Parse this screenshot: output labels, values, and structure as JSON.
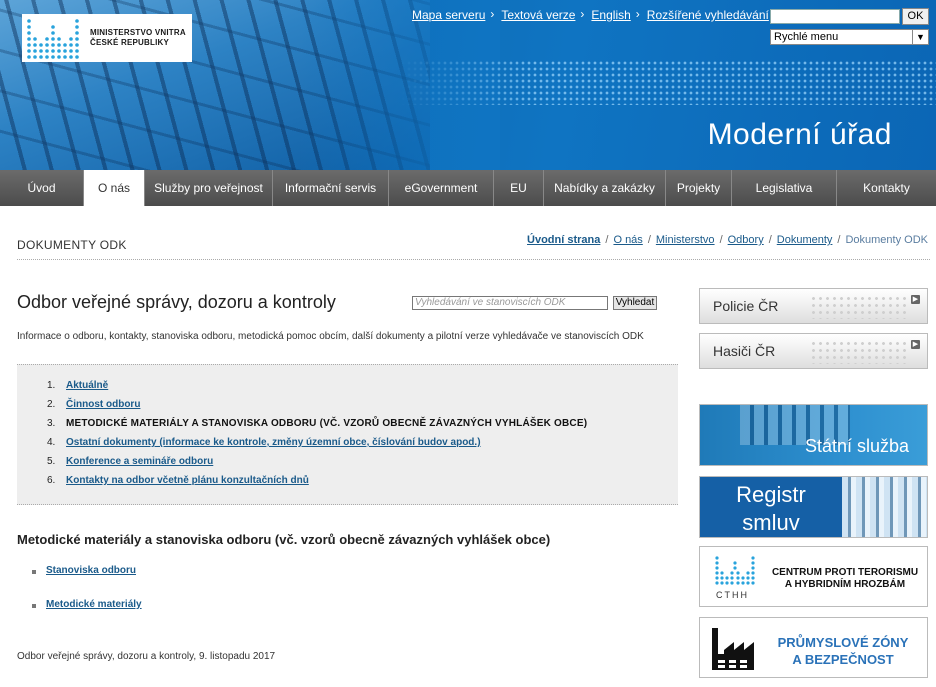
{
  "header": {
    "logo_line1": "MINISTERSTVO VNITRA",
    "logo_line2": "ČESKÉ REPUBLIKY",
    "slogan": "Moderní úřad",
    "top_links": [
      "Mapa serveru",
      "Textová verze",
      "English",
      "Rozšířené vyhledávání"
    ],
    "search_value": "",
    "ok_label": "OK",
    "quick_menu_value": "Rychlé menu"
  },
  "nav": {
    "items": [
      "Úvod",
      "O nás",
      "Služby pro veřejnost",
      "Informační servis",
      "eGovernment",
      "EU",
      "Nabídky a zakázky",
      "Projekty",
      "Legislativa",
      "Kontakty"
    ],
    "active": "O nás"
  },
  "breadcrumb": {
    "section_title": "DOKUMENTY ODK",
    "items": [
      "Úvodní strana",
      "O nás",
      "Ministerstvo",
      "Odbory",
      "Dokumenty"
    ],
    "current": "Dokumenty ODK"
  },
  "main": {
    "title": "Odbor veřejné správy, dozoru a kontroly",
    "search_placeholder": "Vyhledávání ve stanoviscích ODK",
    "search_button": "Vyhledat",
    "intro": "Informace o odboru, kontakty, stanoviska odboru, metodická pomoc obcím, další dokumenty a pilotní verze vyhledávače ve stanoviscích ODK",
    "toc": [
      {
        "num": "1.",
        "label": "Aktuálně",
        "link": true
      },
      {
        "num": "2.",
        "label": "Činnost odboru",
        "link": true
      },
      {
        "num": "3.",
        "label": "METODICKÉ MATERIÁLY A STANOVISKA ODBORU (VČ. VZORŮ OBECNĚ ZÁVAZNÝCH VYHLÁŠEK OBCE)",
        "link": false
      },
      {
        "num": "4.",
        "label": "Ostatní dokumenty (informace ke kontrole, změny územní obce, číslování budov apod.)",
        "link": true
      },
      {
        "num": "5.",
        "label": "Konference a semináře odboru",
        "link": true
      },
      {
        "num": "6.",
        "label": "Kontakty na odbor včetně plánu konzultačních dnů",
        "link": true
      }
    ],
    "subsection_title": "Metodické materiály a stanoviska odboru (vč. vzorů obecně závazných vyhlášek obce)",
    "sub_links": [
      "Stanoviska odboru",
      "Metodické materiály"
    ],
    "footer_note": "Odbor veřejné správy, dozoru a kontroly, 9. listopadu 2017"
  },
  "sidebar": {
    "buttons": [
      "Policie ČR",
      "Hasiči ČR"
    ],
    "banner_statni": "Státní služba",
    "banner_registr_line1": "Registr",
    "banner_registr_line2": "smluv",
    "cthh_abbr": "CTHH",
    "cthh_line1": "CENTRUM PROTI TERORISMU",
    "cthh_line2": "A HYBRIDNÍM HROZBÁM",
    "zony_line1": "PRŮMYSLOVÉ ZÓNY",
    "zony_line2": "A BEZPEČNOST"
  },
  "colors": {
    "header_blue": "#0f74c2",
    "nav_gray": "#5a5a5a",
    "link_blue": "#1a5a8a",
    "zony_blue": "#2a72b8"
  }
}
